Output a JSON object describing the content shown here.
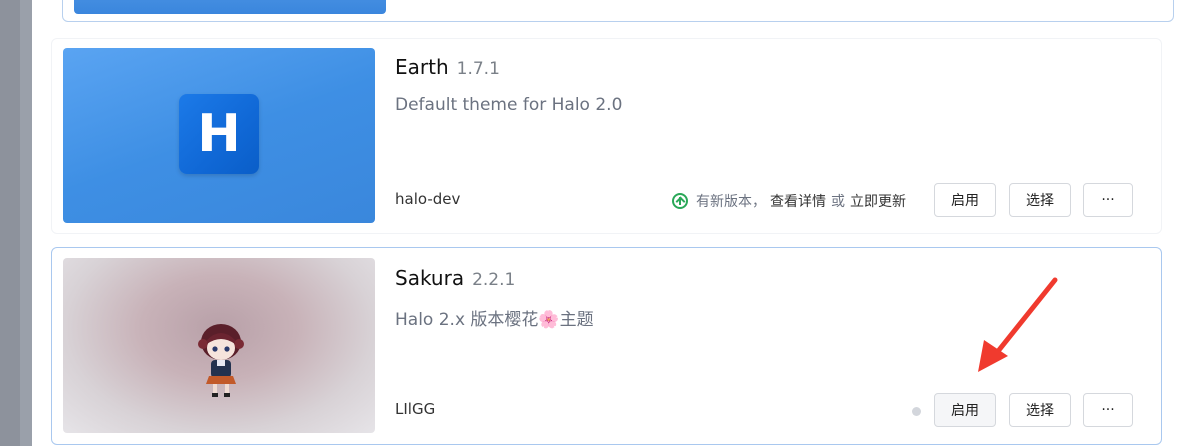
{
  "themes": [
    {
      "name": "Earth",
      "version": "1.7.1",
      "description": "Default theme for Halo 2.0",
      "author": "halo-dev",
      "logo_letter": "H",
      "update_notice": {
        "text": "有新版本，",
        "view_details": "查看详情",
        "or": "或",
        "update_now": "立即更新"
      },
      "buttons": {
        "enable": "启用",
        "select": "选择",
        "more": "···"
      }
    },
    {
      "name": "Sakura",
      "version": "2.2.1",
      "description": "Halo 2.x 版本樱花🌸主题",
      "author": "LIlGG",
      "buttons": {
        "enable": "启用",
        "select": "选择",
        "more": "···"
      }
    }
  ],
  "colors": {
    "accent_blue": "#3a87dc",
    "update_green": "#2aa858",
    "annotation_arrow": "#f03a2e"
  }
}
